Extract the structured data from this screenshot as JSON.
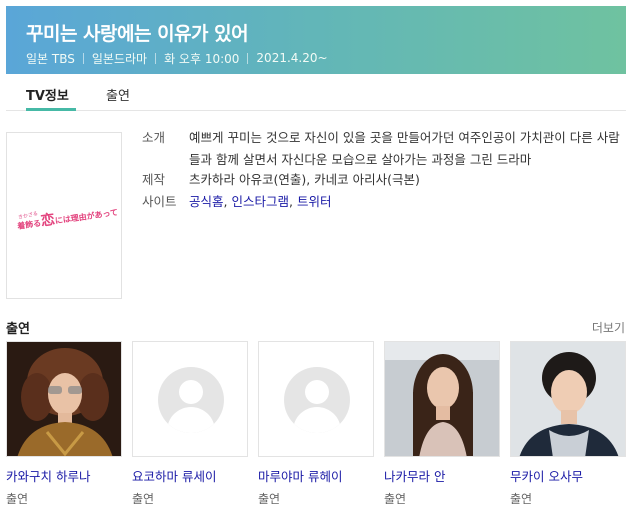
{
  "header": {
    "title": "꾸미는 사랑에는 이유가 있어",
    "meta": [
      "일본 TBS",
      "일본드라마",
      "화 오후 10:00",
      "2021.4.20~"
    ],
    "gradient_colors": [
      "#5aa6d8",
      "#6fc2a0"
    ]
  },
  "tabs": [
    {
      "label": "TV정보",
      "active": true
    },
    {
      "label": "출연",
      "active": false
    }
  ],
  "poster": {
    "logo_small": "きかざる",
    "logo_pre": "着飾る",
    "logo_big": "恋",
    "logo_post": "には理由があって"
  },
  "info": {
    "synopsis_label": "소개",
    "synopsis": "예쁘게 꾸미는 것으로 자신이 있을 곳을 만들어가던 여주인공이 가치관이 다른 사람들과 함께 살면서 자신다운 모습으로 살아가는 과정을 그린 드라마",
    "production_label": "제작",
    "production": "츠카하라 아유코(연출), 카네코 아리사(극본)",
    "site_label": "사이트",
    "sites": [
      "공식홈",
      "인스타그램",
      "트위터"
    ],
    "separator": ","
  },
  "cast_section": {
    "title": "출연",
    "more_label": "더보기",
    "members": [
      {
        "name": "카와구치 하루나",
        "role": "출연",
        "photo": "photo"
      },
      {
        "name": "요코하마 류세이",
        "role": "출연",
        "photo": "placeholder"
      },
      {
        "name": "마루야마 류헤이",
        "role": "출연",
        "photo": "placeholder"
      },
      {
        "name": "나카무라 안",
        "role": "출연",
        "photo": "photo"
      },
      {
        "name": "무카이 오사무",
        "role": "출연",
        "photo": "photo"
      }
    ]
  },
  "colors": {
    "accent": "#46b9a6",
    "link": "#1a1aa6",
    "poster_pink": "#e3457f"
  }
}
